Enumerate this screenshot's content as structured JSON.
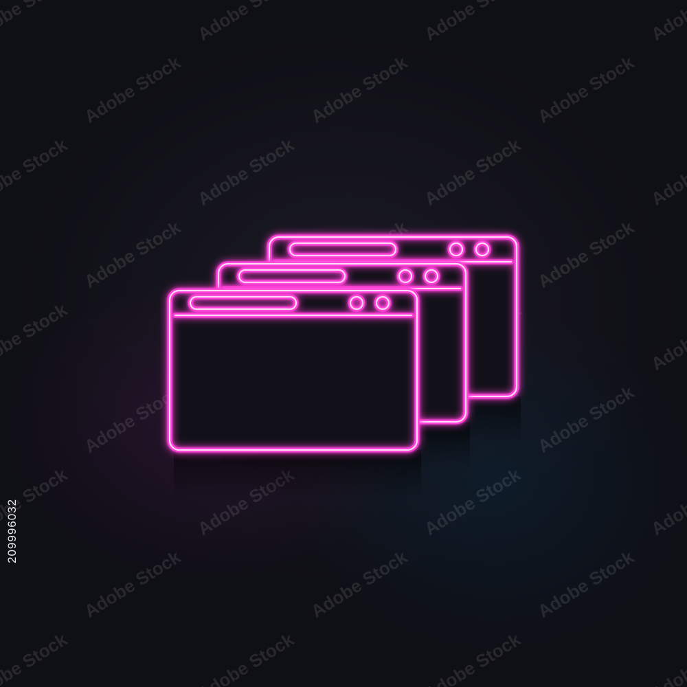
{
  "watermark": {
    "text": "Adobe Stock"
  },
  "stock_id": "209996032",
  "icon": {
    "name": "multiple-browser-windows",
    "neon_color": "#ff3fd8",
    "core_color": "#ffe6fb",
    "window_count": 3
  },
  "colors": {
    "background": "#12111a",
    "glow": "#ff2ad4"
  }
}
